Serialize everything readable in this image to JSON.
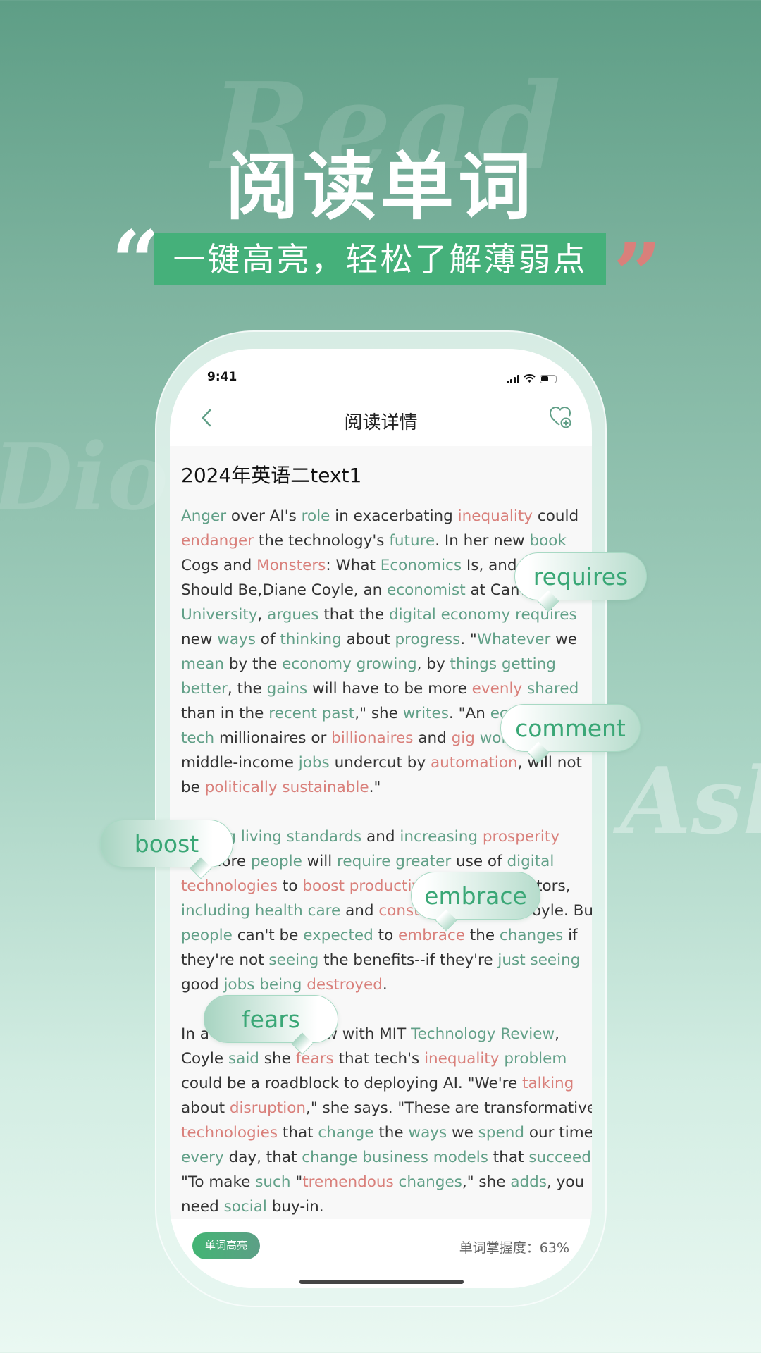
{
  "watermarks": [
    "Read",
    "Dio",
    "Asl"
  ],
  "hero": {
    "title": "阅读单词",
    "subtitle": "一键高亮，轻松了解薄弱点",
    "quote_open": "“",
    "quote_close": "”"
  },
  "colors": {
    "accent": "#45b07a",
    "known_word": "#62a088",
    "weak_word": "#d9807b"
  },
  "status": {
    "time": "9:41",
    "icons": [
      "cellular-signal-icon",
      "wifi-icon",
      "battery-icon"
    ]
  },
  "nav": {
    "title": "阅读详情",
    "back_icon": "chevron-left-icon",
    "favorite_icon": "heart-add-icon"
  },
  "article": {
    "title": "2024年英语二text1",
    "paragraphs": [
      [
        "[g:Anger] over AI's [g:role] in exacerbating [r:inequality] could",
        "[r:endanger] the technology's [g:future]. In her new [g:book]",
        "Cogs and [r:Monsters]: What [g:Economics] Is, and What It",
        "Should Be,Diane Coyle, an [g:economist] at Cambridge",
        "[g:University], [g:argues] that the [g:digital economy requires]",
        "new [g:ways] of [g:thinking] about [g:progress]. \"[g:Whatever] we",
        "[g:mean] by the [g:economy growing], by [g:things getting]",
        "[g:better], the [g:gains] will have to be more [r:evenly] [g:shared]",
        "than in the [g:recent past],\" she [g:writes]. \"An [g:economy] for",
        "[g:tech] millionaires or [r:billionaires] and [r:gig] [g:workers] and",
        "middle-income [g:jobs] undercut by [r:automation], will not",
        "be [r:politically sustainable].\""
      ],
      [
        "[g:Raising living standards] and [g:increasing] [r:prosperity]",
        "for more [g:people] will [g:require greater] use of [g:digital]",
        "[r:technologies] to [r:boost productivity] in many sectors,",
        "[g:including health care] and [r:construction], says Coyle. But",
        "[g:people] can't be [g:expected] to [r:embrace] the [g:changes] if",
        "they're not [g:seeing] the benefits--if they're [g:just seeing]",
        "good [g:jobs being] [r:destroyed]."
      ],
      [
        "In a recent interview with MIT [g:Technology Review],",
        "Coyle [g:said] she [r:fears] that tech's [r:inequality] [g:problem]",
        "could be a roadblock to deploying AI. \"We're [r:talking]",
        "about [r:disruption],\" she says. \"These are transformative",
        "[r:technologies] that [g:change] the [g:ways] we [g:spend] our time",
        "[g:every] day, that [g:change business models] that [g:succeed]",
        "\"To make [g:such] \"[r:tremendous] [g:changes],\" she [g:adds], you",
        "need [g:social] buy-in."
      ]
    ]
  },
  "bubbles": [
    "requires",
    "comment",
    "boost",
    "embrace",
    "fears"
  ],
  "bottom": {
    "highlight_button": "单词高亮",
    "mastery_label": "单词掌握度：",
    "mastery_value": "63%",
    "mastery_percent": 63
  }
}
